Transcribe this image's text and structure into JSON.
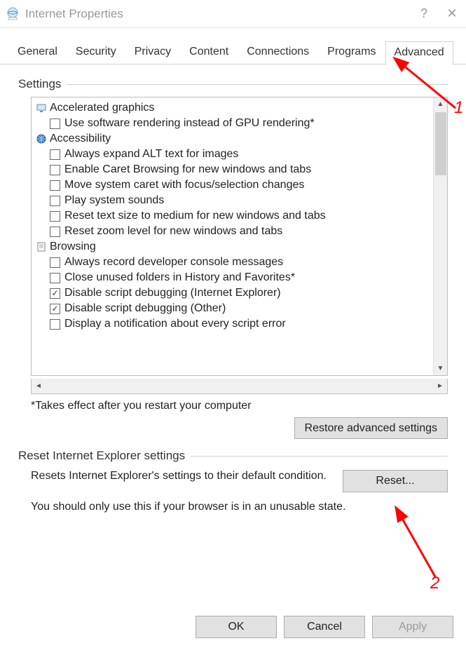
{
  "window": {
    "title": "Internet Properties",
    "help_btn": "?",
    "close_btn": "✕"
  },
  "tabs": {
    "items": [
      {
        "label": "General",
        "active": false
      },
      {
        "label": "Security",
        "active": false
      },
      {
        "label": "Privacy",
        "active": false
      },
      {
        "label": "Content",
        "active": false
      },
      {
        "label": "Connections",
        "active": false
      },
      {
        "label": "Programs",
        "active": false
      },
      {
        "label": "Advanced",
        "active": true
      }
    ]
  },
  "settings": {
    "legend": "Settings",
    "categories": [
      {
        "name": "Accelerated graphics",
        "icon": "monitor-icon",
        "options": [
          {
            "label": "Use software rendering instead of GPU rendering*",
            "checked": false
          }
        ]
      },
      {
        "name": "Accessibility",
        "icon": "globe-icon",
        "options": [
          {
            "label": "Always expand ALT text for images",
            "checked": false
          },
          {
            "label": "Enable Caret Browsing for new windows and tabs",
            "checked": false
          },
          {
            "label": "Move system caret with focus/selection changes",
            "checked": false
          },
          {
            "label": "Play system sounds",
            "checked": false
          },
          {
            "label": "Reset text size to medium for new windows and tabs",
            "checked": false
          },
          {
            "label": "Reset zoom level for new windows and tabs",
            "checked": false
          }
        ]
      },
      {
        "name": "Browsing",
        "icon": "page-icon",
        "options": [
          {
            "label": "Always record developer console messages",
            "checked": false
          },
          {
            "label": "Close unused folders in History and Favorites*",
            "checked": false
          },
          {
            "label": "Disable script debugging (Internet Explorer)",
            "checked": true
          },
          {
            "label": "Disable script debugging (Other)",
            "checked": true
          },
          {
            "label": "Display a notification about every script error",
            "checked": false
          }
        ]
      }
    ],
    "footnote": "*Takes effect after you restart your computer",
    "restore_btn": "Restore advanced settings"
  },
  "reset": {
    "legend": "Reset Internet Explorer settings",
    "text": "Resets Internet Explorer's settings to their default condition.",
    "btn": "Reset...",
    "note": "You should only use this if your browser is in an unusable state."
  },
  "buttons": {
    "ok": "OK",
    "cancel": "Cancel",
    "apply": "Apply"
  },
  "annotations": {
    "one": "1",
    "two": "2"
  }
}
